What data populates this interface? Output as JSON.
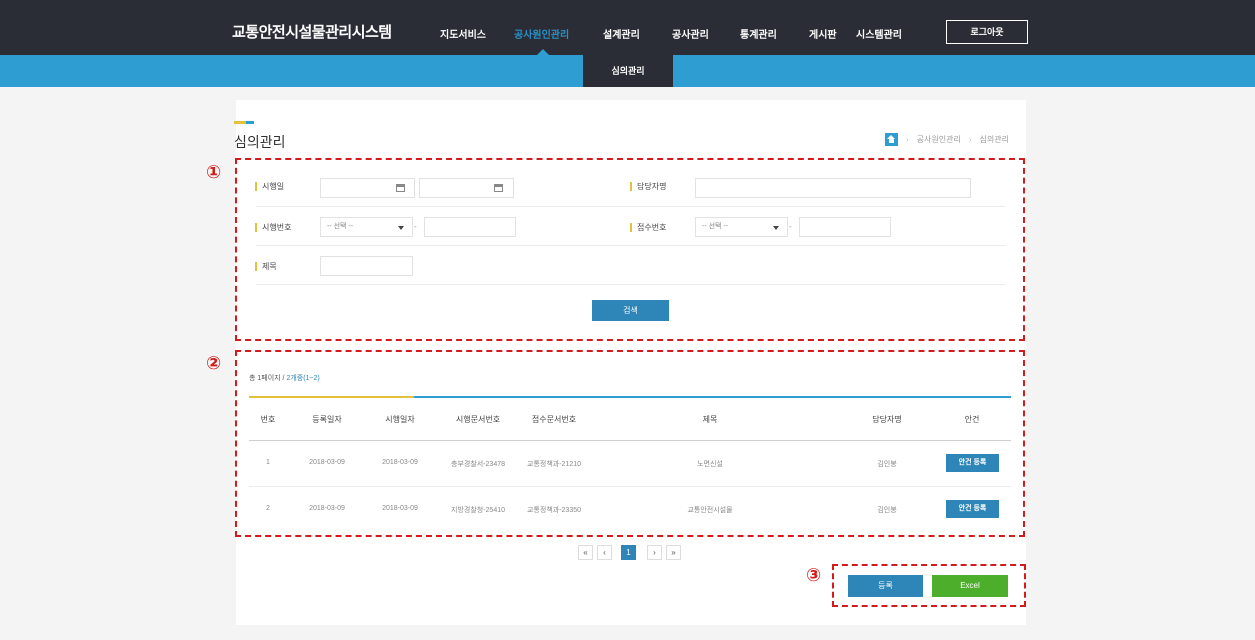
{
  "header": {
    "site_title": "교통안전시설물관리시스템",
    "nav": [
      "지도서비스",
      "공사원인관리",
      "설계관리",
      "공사관리",
      "통계관리",
      "게시판",
      "시스템관리"
    ],
    "active_nav": "공사원인관리",
    "logout_label": "로그아웃",
    "sub_menu": [
      "심의관리"
    ]
  },
  "page": {
    "title": "심의관리",
    "breadcrumb": [
      "공사원인관리",
      "심의관리"
    ]
  },
  "annotations": [
    "①",
    "②",
    "③"
  ],
  "search_form": {
    "exec_date_label": "시행일",
    "manager_label": "담당자명",
    "exec_no_label": "시행번호",
    "exec_no_select": "-- 선택 --",
    "receipt_no_label": "접수번호",
    "receipt_no_select": "-- 선택 --",
    "title_label": "제목",
    "dash": "-",
    "search_button": "검색"
  },
  "results": {
    "page_info_prefix": "총 1페이지 / ",
    "page_info_highlight": "2개중(1~2)",
    "columns": [
      "번호",
      "등록일자",
      "시행일자",
      "시행문서번호",
      "접수문서번호",
      "제목",
      "담당자명",
      "안건"
    ],
    "rows": [
      {
        "no": "1",
        "reg_date": "2018-03-09",
        "exec_date": "2018-03-09",
        "exec_doc": "충부경찰서-23478",
        "receipt_doc": "교통정책과-21210",
        "title": "노면신설",
        "manager": "김인봉",
        "action": "안건 등록"
      },
      {
        "no": "2",
        "reg_date": "2018-03-09",
        "exec_date": "2018-03-09",
        "exec_doc": "지방경찰청-25410",
        "receipt_doc": "교통정책과-23350",
        "title": "교통안전시설물",
        "manager": "김인봉",
        "action": "안건 등록"
      }
    ]
  },
  "pagination": {
    "first": "«",
    "prev": "‹",
    "current": "1",
    "next": "›",
    "last": "»"
  },
  "actions": {
    "register": "등록",
    "excel": "Excel"
  },
  "colors": {
    "header_bg": "#2a2d35",
    "accent_blue": "#2e9dd1",
    "button_blue": "#2e86b8",
    "excel_green": "#4cae2a",
    "accent_yellow": "#e2c23a",
    "annotation_red": "#d31b1b"
  }
}
